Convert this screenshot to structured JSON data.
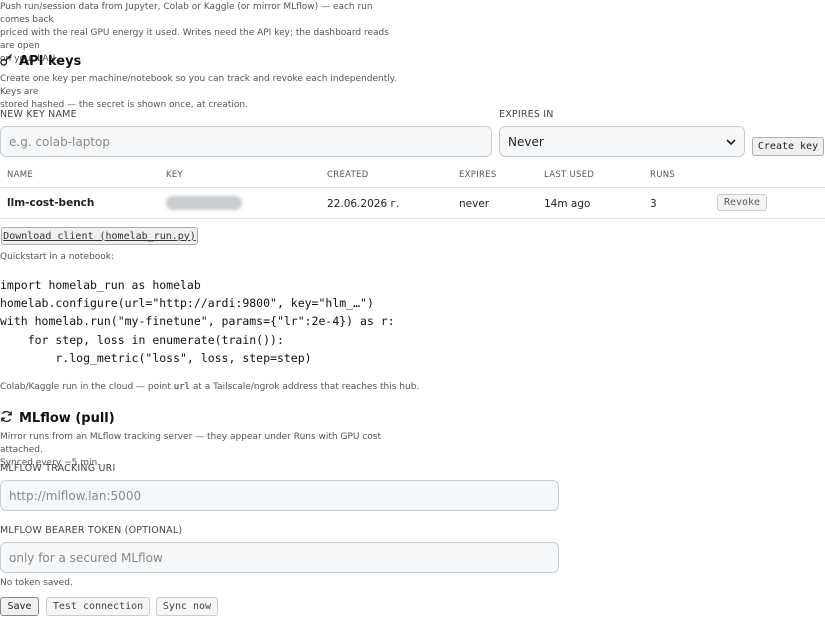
{
  "intro": {
    "line1": "Push run/session data from Jupyter, Colab or Kaggle (or mirror MLflow) — each run comes back",
    "line2": "priced with the real GPU energy it used. Writes need the API key; the dashboard reads are open",
    "line3": "on your LAN."
  },
  "api_keys": {
    "title": "API keys",
    "desc1": "Create one key per machine/notebook so you can track and revoke each independently. Keys are",
    "desc2": "stored hashed — the secret is shown once, at creation.",
    "name_label": "NEW KEY NAME",
    "name_placeholder": "e.g. colab-laptop",
    "expires_label": "EXPIRES IN",
    "expires_value": "Never",
    "create_button": "Create key",
    "columns": [
      "NAME",
      "KEY",
      "CREATED",
      "EXPIRES",
      "LAST USED",
      "RUNS"
    ],
    "rows": [
      {
        "name": "llm-cost-bench",
        "key": "••••••••••",
        "created": "22.06.2026 г.",
        "expires": "never",
        "last_used": "14m ago",
        "runs": "3",
        "action": "Revoke"
      }
    ]
  },
  "client": {
    "download_label": "Download client (homelab_run.py)",
    "quickstart": "Quickstart in a notebook:",
    "code": "import homelab_run as homelab\nhomelab.configure(url=\"http://ardi:9800\", key=\"hlm_…\")\nwith homelab.run(\"my-finetune\", params={\"lr\":2e-4}) as r:\n    for step, loss in enumerate(train()):\n        r.log_metric(\"loss\", loss, step=step)",
    "cloud_note_a": "Colab/Kaggle run in the cloud — point ",
    "cloud_note_code": "url",
    "cloud_note_b": " at a Tailscale/ngrok address that reaches this hub."
  },
  "mlflow": {
    "title": "MLflow (pull)",
    "desc1": "Mirror runs from an MLflow tracking server — they appear under Runs with GPU cost attached.",
    "desc2": "Synced every ~5 min.",
    "uri_label": "MLFLOW TRACKING URI",
    "uri_placeholder": "http://mlflow.lan:5000",
    "token_label": "MLFLOW BEARER TOKEN (OPTIONAL)",
    "token_placeholder": "only for a secured MLflow",
    "token_status": "No token saved.",
    "save_button": "Save",
    "test_button": "Test connection",
    "sync_button": "Sync now"
  }
}
